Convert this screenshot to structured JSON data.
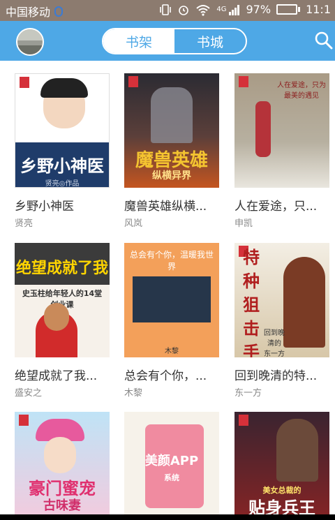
{
  "status_bar": {
    "carrier": "中国移动",
    "network": "4G",
    "battery": "97%",
    "battery_level": 0.97,
    "time": "11:1"
  },
  "app_bar": {
    "tabs": [
      {
        "label": "书架",
        "active": true
      },
      {
        "label": "书城",
        "active": false
      }
    ],
    "icons": {
      "avatar": "user-avatar",
      "search": "search-icon"
    },
    "accent_color": "#4ea8e6"
  },
  "books": [
    {
      "title": "乡野小神医",
      "author": "贤亮",
      "cover_text": "乡野小神医",
      "cover_sub": "贤亮◎作品"
    },
    {
      "title": "魔兽英雄纵横...",
      "author": "风岚",
      "cover_text": "魔兽英雄",
      "cover_sub": "纵横异界"
    },
    {
      "title": "人在爱途，只...",
      "author": "申凯",
      "cover_text": "人在爱途，只为最美的遇见",
      "cover_sub": ""
    },
    {
      "title": "绝望成就了我...",
      "author": "盛安之",
      "cover_text": "绝望成就了我",
      "cover_sub": "史玉柱给年轻人的14堂创业课"
    },
    {
      "title": "总会有个你，...",
      "author": "木黎",
      "cover_text": "总会有个你，温暖我世界",
      "cover_sub": "木黎"
    },
    {
      "title": "回到晚清的特...",
      "author": "东一方",
      "cover_text": "特种狙击手",
      "cover_sub": "回到晚清的 东一方"
    },
    {
      "title": "",
      "author": "",
      "cover_text": "豪门蜜宠",
      "cover_sub": "古味妻"
    },
    {
      "title": "",
      "author": "",
      "cover_text": "美颜APP",
      "cover_sub": "系统"
    },
    {
      "title": "",
      "author": "",
      "cover_text": "贴身兵王",
      "cover_sub": "美女总裁的"
    }
  ]
}
